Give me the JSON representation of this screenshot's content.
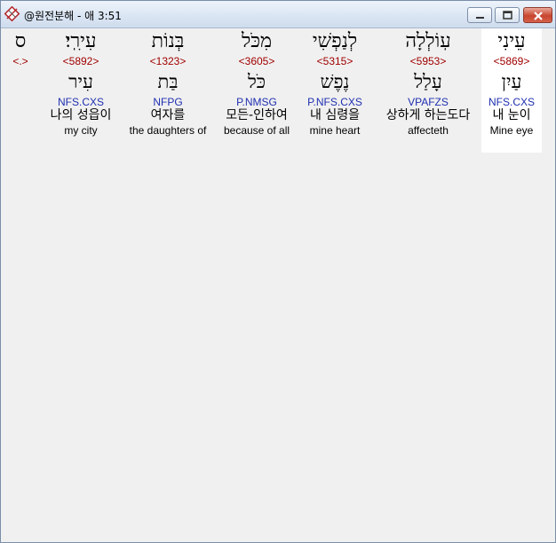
{
  "window": {
    "title": "@원전분해 - 애 3:51"
  },
  "words": [
    {
      "heb": "עֵינִי",
      "strong": "<5869>",
      "root": "עַיִן",
      "parse": "NFS.CXS",
      "kor": "내 눈이",
      "eng": "Mine eye",
      "selected": true
    },
    {
      "heb": "עֽוֹלְלָה",
      "strong": "<5953>",
      "root": "עָלַל",
      "parse": "VPAFZS",
      "kor": "상하게 하는도다",
      "eng": "affecteth",
      "selected": false
    },
    {
      "heb": "לְנַפְשִׁי",
      "strong": "<5315>",
      "root": "נֶפֶשׁ",
      "parse": "P.NFS.CXS",
      "kor": "내 심령을",
      "eng": "mine heart",
      "selected": false
    },
    {
      "heb": "מִכֹּל",
      "strong": "<3605>",
      "root": "כֹּל",
      "parse": "P.NMSG",
      "kor": "모든-인하여",
      "eng": "because of all",
      "selected": false
    },
    {
      "heb": "בְּנוֹת",
      "strong": "<1323>",
      "root": "בַּת",
      "parse": "NFPG",
      "kor": "여자를",
      "eng": "the daughters of",
      "selected": false
    },
    {
      "heb": "עִירִֽי׃",
      "strong": "<5892>",
      "root": "עִיר",
      "parse": "NFS.CXS",
      "kor": "나의 성읍이",
      "eng": "my city",
      "selected": false
    },
    {
      "heb": "ס",
      "strong": "<.>",
      "root": "",
      "parse": "",
      "kor": "",
      "eng": "",
      "selected": false
    }
  ]
}
